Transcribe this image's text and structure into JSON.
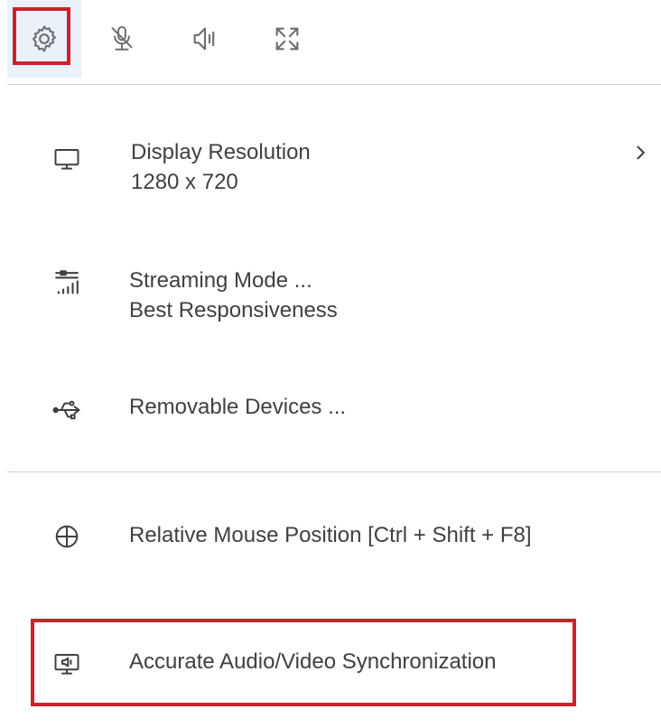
{
  "toolbar": {
    "buttons": [
      {
        "name": "settings",
        "icon": "gear-icon",
        "selected": true
      },
      {
        "name": "microphone",
        "icon": "microphone-muted-icon"
      },
      {
        "name": "volume",
        "icon": "speaker-icon"
      },
      {
        "name": "fullscreen",
        "icon": "expand-icon"
      }
    ]
  },
  "menu": {
    "display_resolution": {
      "label": "Display Resolution",
      "value": "1280 x 720",
      "icon": "monitor-icon",
      "trailing_icon": "chevron-right-icon"
    },
    "streaming_mode": {
      "label": "Streaming Mode ...",
      "value": "Best Responsiveness",
      "icon": "signal-sliders-icon"
    },
    "removable_devices": {
      "label": "Removable Devices ...",
      "icon": "usb-icon"
    },
    "relative_mouse": {
      "label": "Relative Mouse Position [Ctrl + Shift + F8]",
      "icon": "crosshair-icon"
    },
    "av_sync": {
      "label": "Accurate Audio/Video Synchronization",
      "icon": "monitor-speaker-icon"
    }
  },
  "colors": {
    "highlight": "#d0202f",
    "selected_bg": "#e9f1f9",
    "text": "#404040",
    "divider": "#cfcfcf"
  }
}
